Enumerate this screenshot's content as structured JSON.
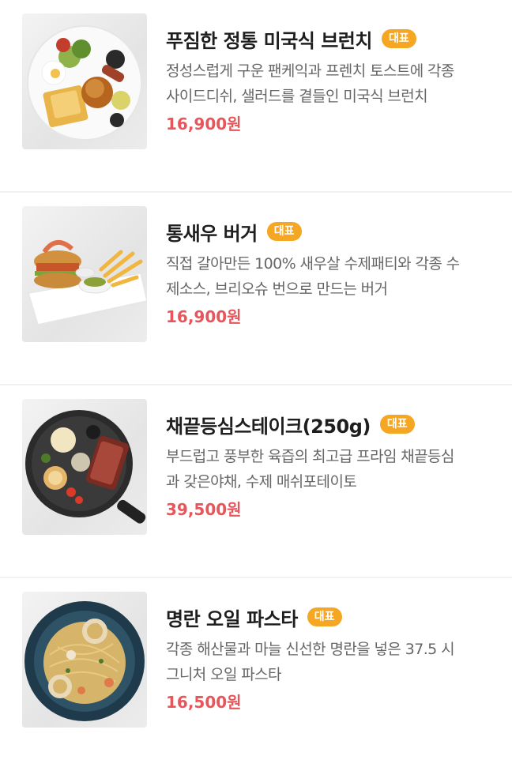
{
  "colors": {
    "badge": "#f5a623",
    "price": "#e8555a",
    "title": "#1e1e1e",
    "description": "#666666"
  },
  "menu": {
    "items": [
      {
        "name": "푸짐한 정통 미국식 브런치",
        "badge": "대표",
        "desc_line1": "정성스럽게 구운 팬케익과 프렌치 토스트에 각종",
        "desc_line2": "사이드디쉬, 샐러드를 곁들인 미국식 브런치",
        "price": "16,900원",
        "image_icon": "brunch-plate-photo"
      },
      {
        "name": "통새우 버거",
        "badge": "대표",
        "desc_line1": "직접 갈아만든 100% 새우살 수제패티와 각종 수",
        "desc_line2": "제소스, 브리오슈 번으로 만드는 버거",
        "price": "16,900원",
        "image_icon": "shrimp-burger-photo"
      },
      {
        "name": "채끝등심스테이크(250g)",
        "badge": "대표",
        "desc_line1": "부드럽고 풍부한 육즙의 최고급 프라임 채끝등심",
        "desc_line2": "과 갖은야채, 수제 매쉬포테이토",
        "price": "39,500원",
        "image_icon": "steak-skillet-photo"
      },
      {
        "name": "명란 오일 파스타",
        "badge": "대표",
        "desc_line1": "각종 해산물과 마늘 신선한 명란을 넣은 37.5 시",
        "desc_line2": "그니처 오일 파스타",
        "price": "16,500원",
        "image_icon": "pasta-bowl-photo"
      }
    ]
  }
}
